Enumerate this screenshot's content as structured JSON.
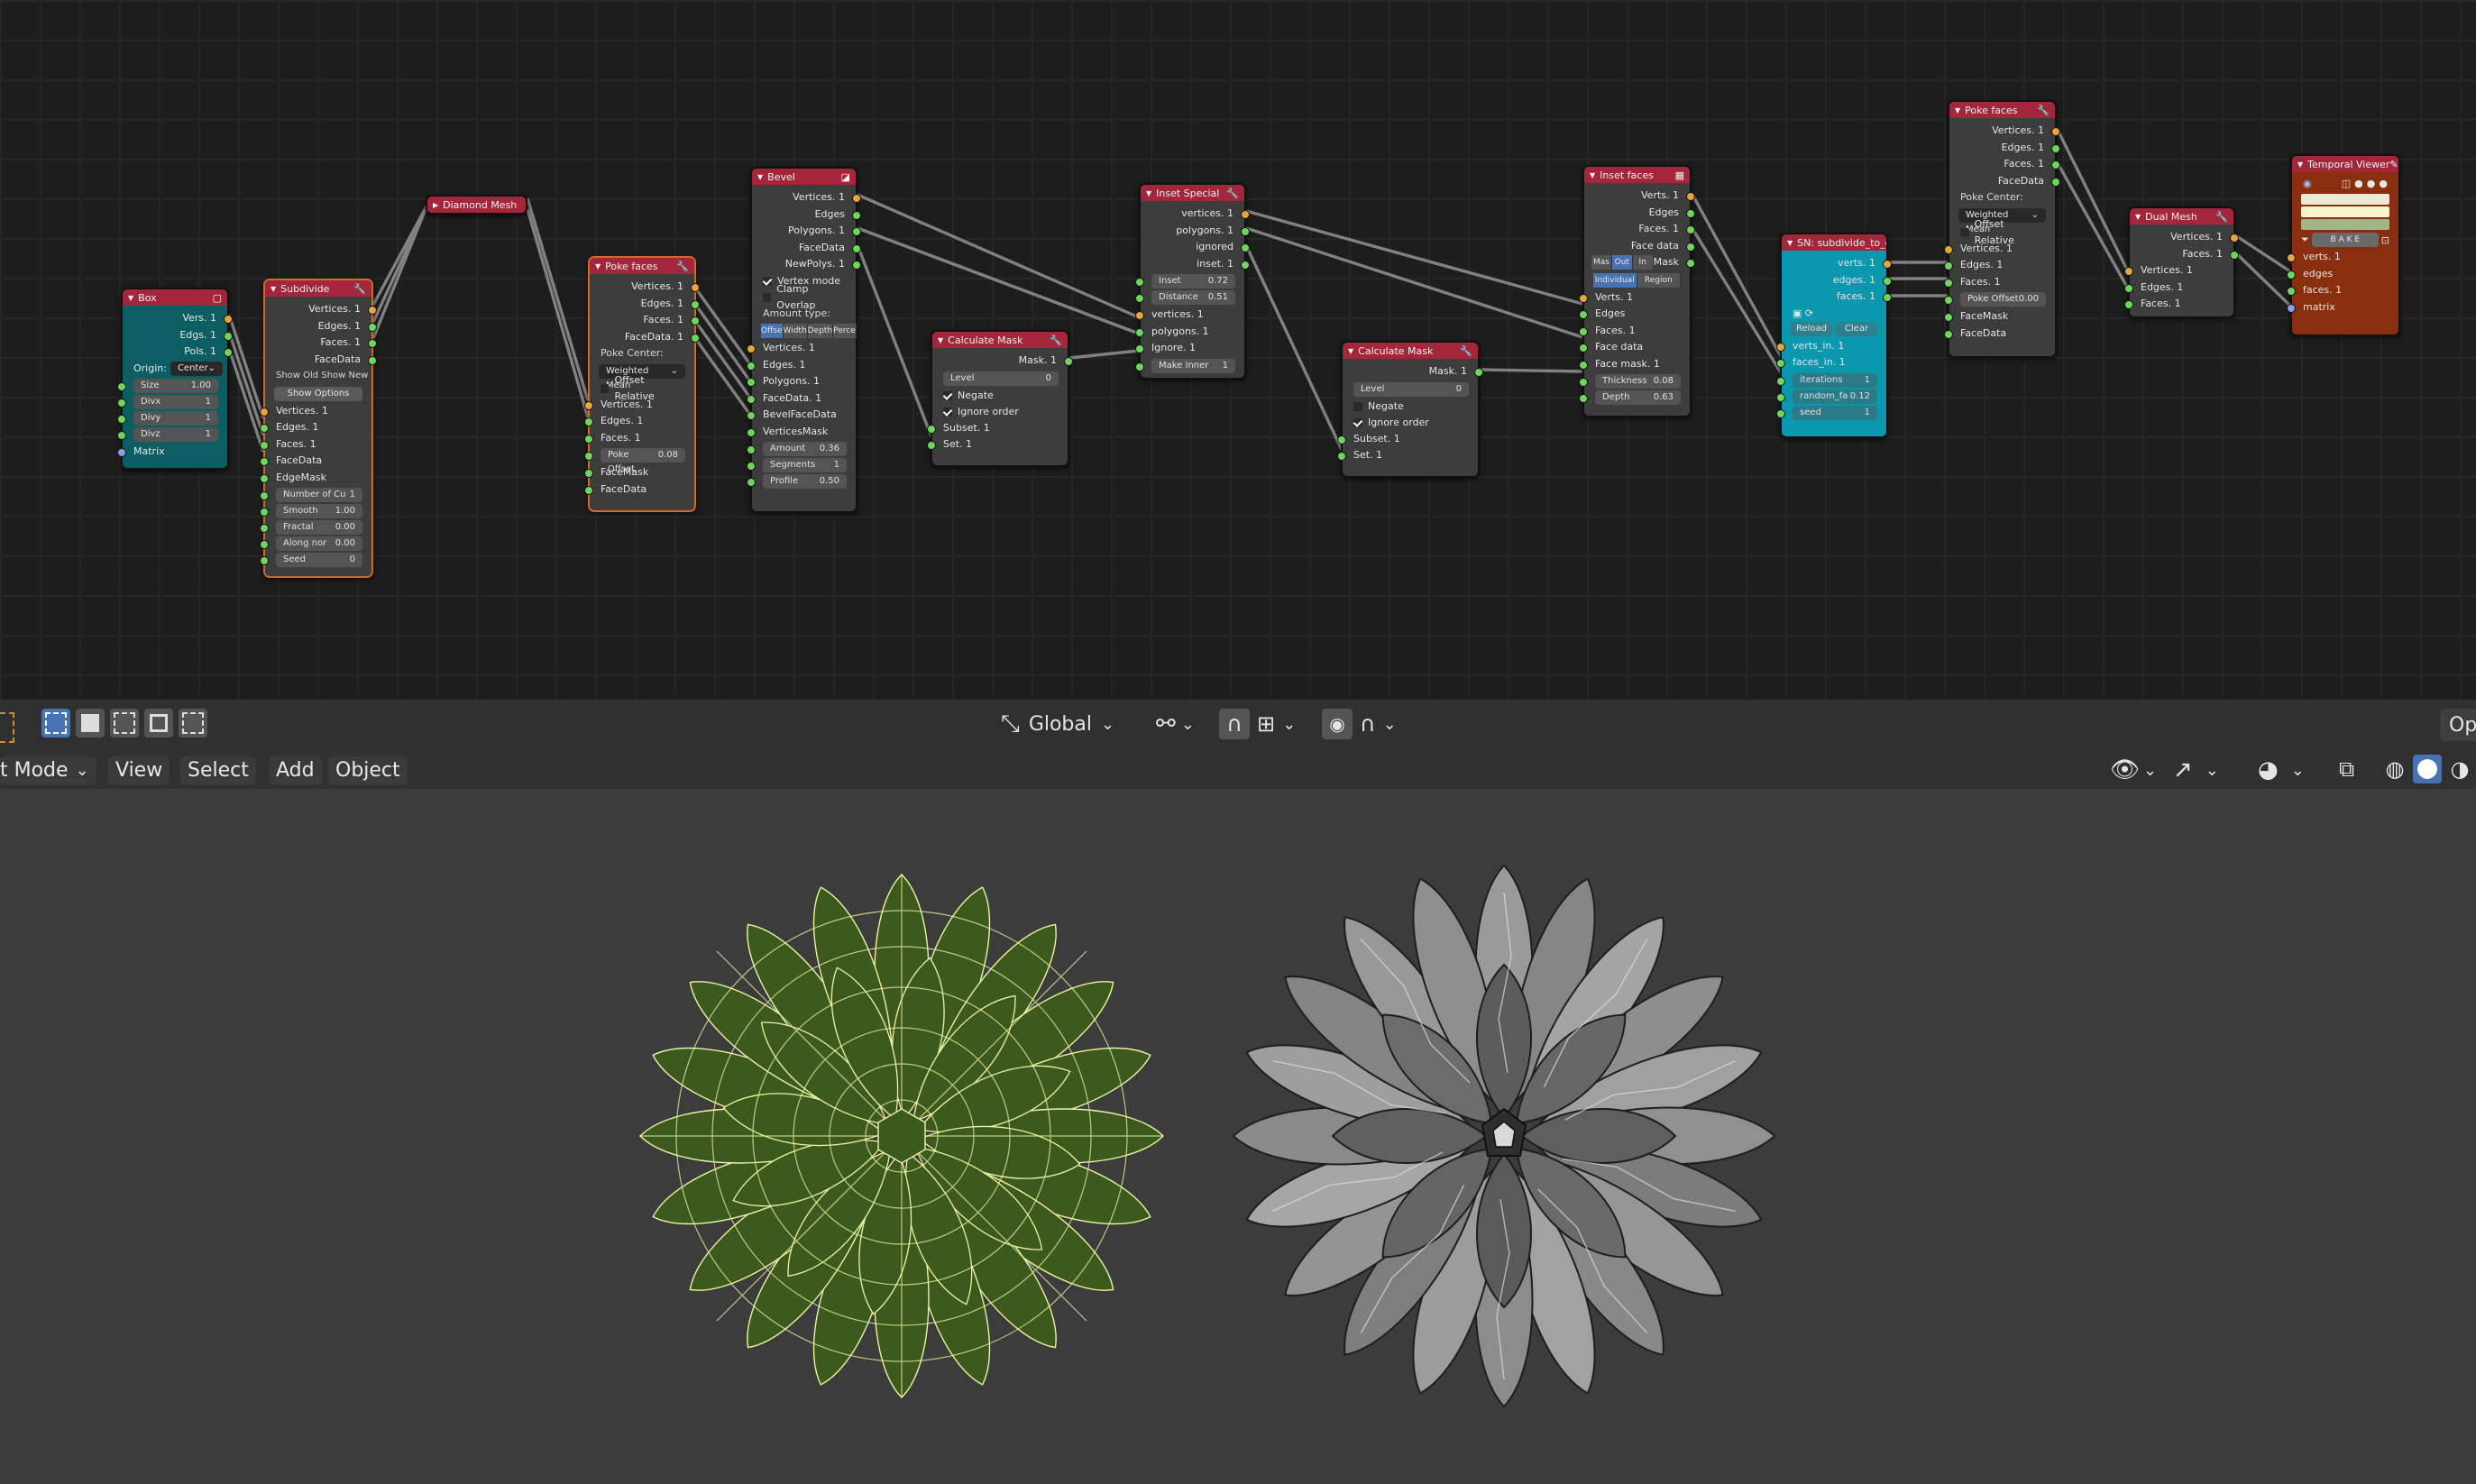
{
  "nodes": {
    "box": {
      "title": "Box",
      "outputs": [
        "Vers. 1",
        "Edgs. 1",
        "Pols. 1"
      ],
      "origin_label": "Origin:",
      "origin_value": "Center",
      "fields": [
        {
          "k": "Size",
          "v": "1.00"
        },
        {
          "k": "Divx",
          "v": "1"
        },
        {
          "k": "Divy",
          "v": "1"
        },
        {
          "k": "Divz",
          "v": "1"
        }
      ],
      "matrix": "Matrix"
    },
    "subdivide": {
      "title": "Subdivide",
      "outputs": [
        "Vertices. 1",
        "Edges. 1",
        "Faces. 1",
        "FaceData"
      ],
      "show_old": "Show Old",
      "show_new": "Show New",
      "show_options": "Show Options",
      "inputs": [
        "Vertices. 1",
        "Edges. 1",
        "Faces. 1",
        "FaceData",
        "EdgeMask"
      ],
      "fields": [
        {
          "k": "Number of Cu",
          "v": "1"
        },
        {
          "k": "Smooth",
          "v": "1.00"
        },
        {
          "k": "Fractal",
          "v": "0.00"
        },
        {
          "k": "Along nor",
          "v": "0.00"
        },
        {
          "k": "Seed",
          "v": "0"
        }
      ]
    },
    "diamond": {
      "title": "Diamond Mesh"
    },
    "poke1": {
      "title": "Poke faces",
      "outputs": [
        "Vertices. 1",
        "Edges. 1",
        "Faces. 1",
        "FaceData. 1"
      ],
      "pole_center": "Poke Center:",
      "pole_value": "Weighted Mean",
      "offset_relative": "Offset Relative",
      "inputs": [
        "Vertices. 1",
        "Edges. 1",
        "Faces. 1"
      ],
      "offset": {
        "k": "Poke Offset",
        "v": "0.08"
      },
      "tail": [
        "FaceMask",
        "FaceData"
      ]
    },
    "bevel": {
      "title": "Bevel",
      "outputs": [
        "Vertices. 1",
        "Edges",
        "Polygons. 1",
        "FaceData",
        "NewPolys. 1"
      ],
      "vertex_mode": "Vertex mode",
      "clamp": "Clamp Overlap",
      "amount_type": "Amount type:",
      "seg": [
        "Offse",
        "Width",
        "Depth",
        "Perce"
      ],
      "inputs": [
        "Vertices. 1",
        "Edges. 1",
        "Polygons. 1",
        "FaceData. 1",
        "BevelFaceData",
        "VerticesMask"
      ],
      "fields": [
        {
          "k": "Amount",
          "v": "0.36"
        },
        {
          "k": "Segments",
          "v": "1"
        },
        {
          "k": "Profile",
          "v": "0.50"
        }
      ]
    },
    "mask1": {
      "title": "Calculate Mask",
      "output": "Mask. 1",
      "level": {
        "k": "Level",
        "v": "0"
      },
      "negate": "Negate",
      "ignore": "Ignore order",
      "inputs": [
        "Subset. 1",
        "Set. 1"
      ]
    },
    "inset_special": {
      "title": "Inset Special",
      "outputs": [
        "vertices. 1",
        "polygons. 1",
        "ignored",
        "inset. 1"
      ],
      "fields": [
        {
          "k": "Inset",
          "v": "0.72"
        },
        {
          "k": "Distance",
          "v": "0.51"
        }
      ],
      "inputs": [
        "vertices. 1",
        "polygons. 1",
        "Ignore. 1"
      ],
      "make_inner": {
        "k": "Make Inner",
        "v": "1"
      }
    },
    "mask2": {
      "title": "Calculate Mask",
      "output": "Mask. 1",
      "level": {
        "k": "Level",
        "v": "0"
      },
      "negate": "Negate",
      "ignore": "Ignore order",
      "inputs": [
        "Subset. 1",
        "Set. 1"
      ]
    },
    "inset_faces": {
      "title": "Inset faces",
      "outputs": [
        "Verts. 1",
        "Edges",
        "Faces. 1",
        "Face data",
        "Mask"
      ],
      "seg": [
        "Mas",
        "Out",
        "In"
      ],
      "seg2": [
        "Individual",
        "Region"
      ],
      "inputs": [
        "Verts. 1",
        "Edges",
        "Faces. 1",
        "Face data",
        "Face mask. 1"
      ],
      "fields": [
        {
          "k": "Thickness",
          "v": "0.08"
        },
        {
          "k": "Depth",
          "v": "0.63"
        }
      ]
    },
    "sn": {
      "title": "SN: subdivide_to_q",
      "outputs": [
        "verts. 1",
        "edges. 1",
        "faces. 1"
      ],
      "reload": "Reload",
      "clear": "Clear",
      "inputs": [
        "verts_in. 1",
        "faces_in. 1"
      ],
      "fields": [
        {
          "k": "iterations",
          "v": "1"
        },
        {
          "k": "random_fa",
          "v": "0.12"
        },
        {
          "k": "seed",
          "v": "1"
        }
      ]
    },
    "poke2": {
      "title": "Poke faces",
      "outputs": [
        "Vertices. 1",
        "Edges. 1",
        "Faces. 1",
        "FaceData"
      ],
      "pole_center": "Poke Center:",
      "pole_value": "Weighted Mean",
      "offset_relative": "Offset Relative",
      "inputs": [
        "Vertices. 1",
        "Edges. 1",
        "Faces. 1"
      ],
      "offset": {
        "k": "Poke Offset",
        "v": "0.00"
      },
      "tail": [
        "FaceMask",
        "FaceData"
      ]
    },
    "dual": {
      "title": "Dual Mesh",
      "outputs": [
        "Vertices. 1",
        "Faces. 1"
      ],
      "inputs": [
        "Vertices. 1",
        "Edges. 1",
        "Faces. 1"
      ]
    },
    "viewer": {
      "title": "Temporal Viewer",
      "bake": "B A K E",
      "inputs": [
        "verts. 1",
        "edges",
        "faces. 1",
        "matrix"
      ]
    }
  },
  "toolbar": {
    "orientation": "Global"
  },
  "menubar": {
    "mode": "t Mode",
    "view": "View",
    "select": "Select",
    "add": "Add",
    "object": "Object",
    "right_label": "Op"
  },
  "colors": {
    "node_header": "#a3263a",
    "wire": "#9a9a9a",
    "wire_mesh": "#f0f0a0",
    "mesh_fill": "#3c5a1e"
  }
}
